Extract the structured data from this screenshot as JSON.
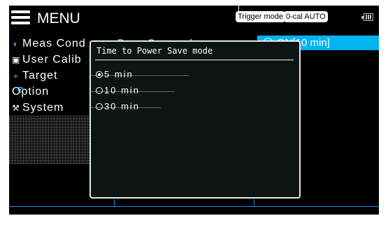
{
  "header": {
    "title": "MENU",
    "menu_icon": "hamburger-menu-icon",
    "trigger_chip": "Trigger mode",
    "zerocal_chip": "0-cal AUTO",
    "battery_icon": "battery-icon"
  },
  "menu": {
    "items": [
      {
        "label": "Meas Cond",
        "icon": "meas-icon"
      },
      {
        "label": "User Calib",
        "icon": "user-calib-icon"
      },
      {
        "label": "Target",
        "icon": "target-icon"
      },
      {
        "label": "Option",
        "icon": "option-gear-icon"
      },
      {
        "label": "System",
        "icon": "system-tools-icon"
      }
    ]
  },
  "background_panel": {
    "selected_item_label": "Power Save mode",
    "selected_value": "ON[10 min]"
  },
  "popup": {
    "title": "Time to Power Save mode",
    "options": [
      {
        "label": "5 min",
        "checked": true
      },
      {
        "label": "10 min",
        "checked": false
      },
      {
        "label": "30 min",
        "checked": false
      }
    ]
  },
  "colors": {
    "accent_cyan": "#00b4f0",
    "background": "#000000",
    "popup_border": "#e8e8e8"
  }
}
